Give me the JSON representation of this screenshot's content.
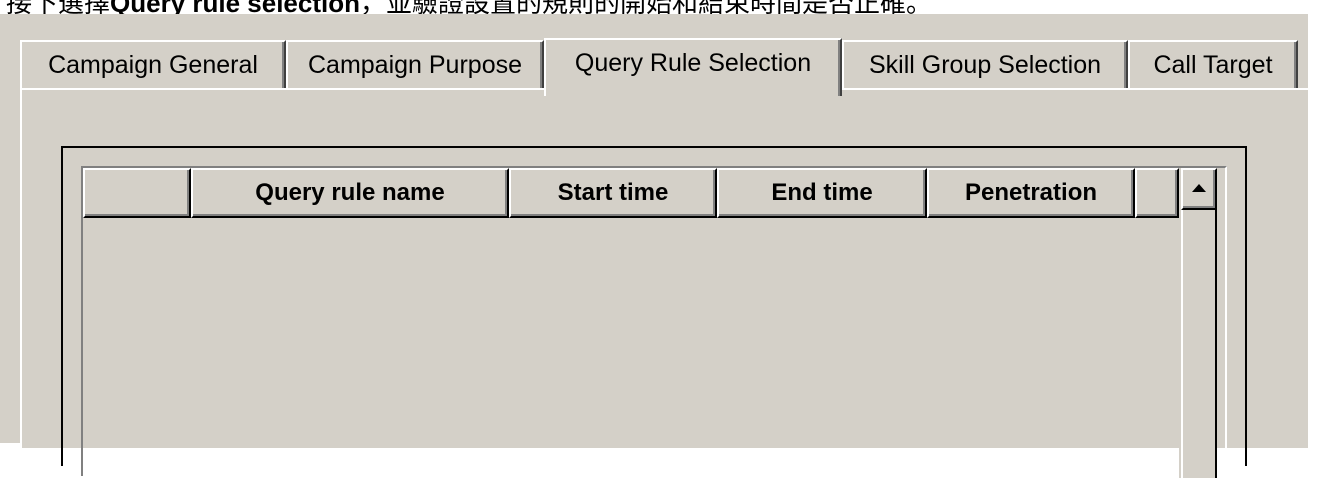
{
  "caption": {
    "prefix": "接下選擇",
    "bold": "Query rule selection",
    "suffix": "，並驗證設置的規則的開始和結束時間是否正確。"
  },
  "tabs": [
    {
      "label": "Campaign General",
      "active": false
    },
    {
      "label": "Campaign Purpose",
      "active": false
    },
    {
      "label": "Query Rule Selection",
      "active": true
    },
    {
      "label": "Skill Group Selection",
      "active": false
    },
    {
      "label": "Call Target",
      "active": false
    }
  ],
  "grid": {
    "columns": [
      "",
      "Query rule name",
      "Start time",
      "End time",
      "Penetration",
      ""
    ],
    "rows": []
  },
  "scrollbar": {
    "up_icon": "up-arrow-icon"
  },
  "colors": {
    "dialog_face": "#d4d0c8",
    "highlight": "#ffffff",
    "shadow": "#808080",
    "dark_shadow": "#000000"
  }
}
